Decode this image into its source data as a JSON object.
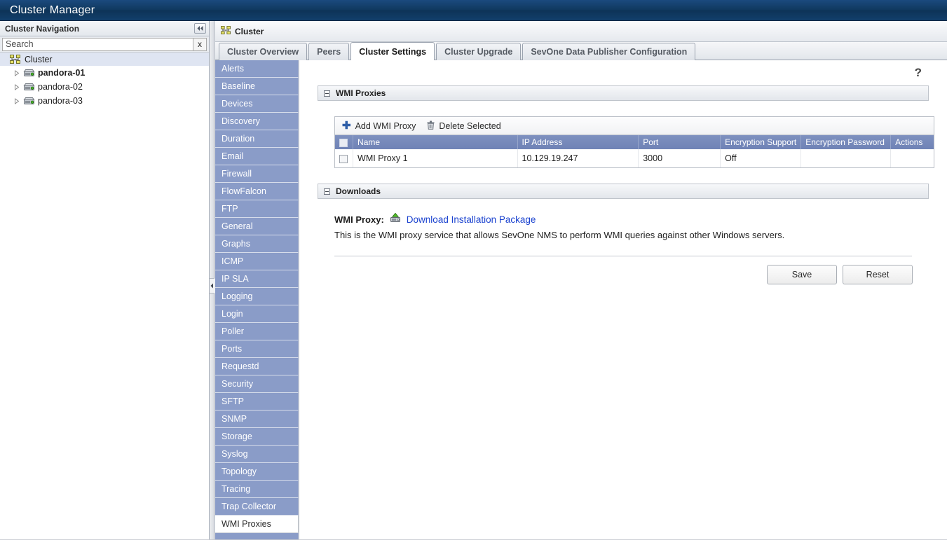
{
  "window": {
    "app_title": "Cluster Manager"
  },
  "left_nav": {
    "header_label": "Cluster Navigation",
    "collapse_icon": "double-chevron-left-icon",
    "search": {
      "placeholder": "Search",
      "value": "",
      "clear_label": "x"
    },
    "tree": {
      "root": {
        "label": "Cluster",
        "icon": "cluster-icon"
      },
      "nodes": [
        {
          "label": "pandora-01",
          "icon": "server-icon",
          "bold": true
        },
        {
          "label": "pandora-02",
          "icon": "server-icon",
          "bold": false
        },
        {
          "label": "pandora-03",
          "icon": "server-icon",
          "bold": false
        }
      ]
    }
  },
  "content": {
    "breadcrumb": {
      "icon": "cluster-icon",
      "label": "Cluster"
    },
    "tabs": [
      {
        "label": "Cluster Overview",
        "active": false
      },
      {
        "label": "Peers",
        "active": false
      },
      {
        "label": "Cluster Settings",
        "active": true
      },
      {
        "label": "Cluster Upgrade",
        "active": false
      },
      {
        "label": "SevOne Data Publisher Configuration",
        "active": false
      }
    ],
    "help_icon_label": "?",
    "settings_menu": [
      {
        "label": "Alerts",
        "active": false
      },
      {
        "label": "Baseline",
        "active": false
      },
      {
        "label": "Devices",
        "active": false
      },
      {
        "label": "Discovery",
        "active": false
      },
      {
        "label": "Duration",
        "active": false
      },
      {
        "label": "Email",
        "active": false
      },
      {
        "label": "Firewall",
        "active": false
      },
      {
        "label": "FlowFalcon",
        "active": false
      },
      {
        "label": "FTP",
        "active": false
      },
      {
        "label": "General",
        "active": false
      },
      {
        "label": "Graphs",
        "active": false
      },
      {
        "label": "ICMP",
        "active": false
      },
      {
        "label": "IP SLA",
        "active": false
      },
      {
        "label": "Logging",
        "active": false
      },
      {
        "label": "Login",
        "active": false
      },
      {
        "label": "Poller",
        "active": false
      },
      {
        "label": "Ports",
        "active": false
      },
      {
        "label": "Requestd",
        "active": false
      },
      {
        "label": "Security",
        "active": false
      },
      {
        "label": "SFTP",
        "active": false
      },
      {
        "label": "SNMP",
        "active": false
      },
      {
        "label": "Storage",
        "active": false
      },
      {
        "label": "Syslog",
        "active": false
      },
      {
        "label": "Topology",
        "active": false
      },
      {
        "label": "Tracing",
        "active": false
      },
      {
        "label": "Trap Collector",
        "active": false
      },
      {
        "label": "WMI Proxies",
        "active": true
      }
    ],
    "wmi_proxies_section": {
      "title": "WMI Proxies",
      "toolbar": {
        "add_label": "Add WMI Proxy",
        "add_icon": "plus-icon",
        "delete_label": "Delete Selected",
        "delete_icon": "trash-icon"
      },
      "columns": [
        "Name",
        "IP Address",
        "Port",
        "Encryption Support",
        "Encryption Password",
        "Actions"
      ],
      "rows": [
        {
          "name": "WMI Proxy 1",
          "ip_address": "10.129.19.247",
          "port": "3000",
          "encryption_support": "Off",
          "encryption_password": "",
          "actions": ""
        }
      ]
    },
    "downloads_section": {
      "title": "Downloads",
      "item_label": "WMI Proxy:",
      "download_icon": "download-drive-icon",
      "link_label": "Download Installation Package",
      "description": "This is the WMI proxy service that allows SevOne NMS to perform WMI queries against other Windows servers."
    },
    "footer_buttons": {
      "save_label": "Save",
      "reset_label": "Reset"
    }
  },
  "colors": {
    "titlebar": "#123f6b",
    "menu_blue": "#8a9cc8",
    "grid_header": "#6f83b6",
    "link_blue": "#1a42cf",
    "tree_selected": "#dfe5f2"
  }
}
